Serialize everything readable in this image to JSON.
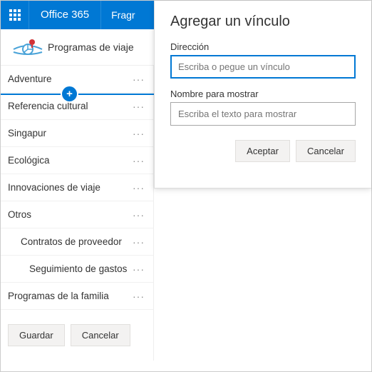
{
  "topbar": {
    "brand": "Office 365",
    "tab": "Fragr"
  },
  "site": {
    "title": "Programas de viaje"
  },
  "nav": {
    "items": [
      {
        "label": "Adventure",
        "indent": 0
      },
      {
        "label": "Referencia cultural",
        "indent": 0
      },
      {
        "label": "Singapur",
        "indent": 0
      },
      {
        "label": "Ecológica",
        "indent": 0
      },
      {
        "label": "Innovaciones de viaje",
        "indent": 0
      },
      {
        "label": "Otros",
        "indent": 0
      },
      {
        "label": "Contratos de proveedor",
        "indent": 1
      },
      {
        "label": "Seguimiento de gastos",
        "indent": 2
      },
      {
        "label": "Programas de la familia",
        "indent": 0
      }
    ],
    "save": "Guardar",
    "cancel": "Cancelar"
  },
  "dialog": {
    "title": "Agregar un vínculo",
    "address_label": "Dirección",
    "address_placeholder": "Escriba o pegue un vínculo",
    "display_label": "Nombre para mostrar",
    "display_placeholder": "Escriba el texto para mostrar",
    "ok": "Aceptar",
    "cancel": "Cancelar"
  }
}
